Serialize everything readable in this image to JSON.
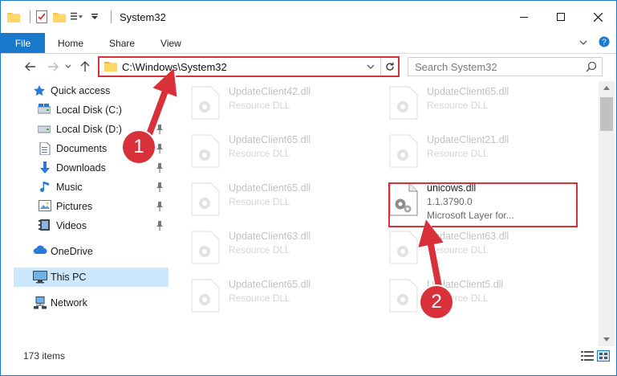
{
  "window": {
    "title": "System32",
    "accent": "#1979ca",
    "highlight_color": "#d9313a"
  },
  "ribbon": {
    "tabs": [
      "File",
      "Home",
      "Share",
      "View"
    ]
  },
  "address": {
    "path": "C:\\Windows\\System32",
    "search_placeholder": "Search System32"
  },
  "nav": {
    "quick_access": "Quick access",
    "items": [
      {
        "label": "Local Disk (C:)",
        "icon": "drive-icon",
        "pinned": true
      },
      {
        "label": "Local Disk (D:)",
        "icon": "drive-icon",
        "pinned": true
      },
      {
        "label": "Documents",
        "icon": "documents-icon",
        "pinned": true
      },
      {
        "label": "Downloads",
        "icon": "downloads-icon",
        "pinned": true
      },
      {
        "label": "Music",
        "icon": "music-icon",
        "pinned": true
      },
      {
        "label": "Pictures",
        "icon": "pictures-icon",
        "pinned": true
      },
      {
        "label": "Videos",
        "icon": "videos-icon",
        "pinned": true
      }
    ],
    "onedrive": "OneDrive",
    "thispc": "This PC",
    "network": "Network"
  },
  "files": [
    {
      "name": "UpdateClient42.dll",
      "type": "Resource DLL"
    },
    {
      "name": "UpdateClient65.dll",
      "type": "Resource DLL"
    },
    {
      "name": "UpdateClient65.dll",
      "type": "Resource DLL"
    },
    {
      "name": "UpdateClient21.dll",
      "type": "Resource DLL"
    },
    {
      "name": "UpdateClient65.dll",
      "type": "Resource DLL"
    },
    {
      "name": "unicows.dll",
      "version": "1.1.3790.0",
      "type": "Microsoft Layer for..."
    },
    {
      "name": "UpdateClient63.dll",
      "type": "Resource DLL"
    },
    {
      "name": "UpdateClient63.dll",
      "type": "Resource DLL"
    },
    {
      "name": "UpdateClient65.dll",
      "type": "Resource DLL"
    },
    {
      "name": "UpdateClient5.dll",
      "type": "Resource DLL"
    }
  ],
  "status": {
    "count": "173 items"
  },
  "annotations": {
    "step1": "1",
    "step2": "2"
  }
}
